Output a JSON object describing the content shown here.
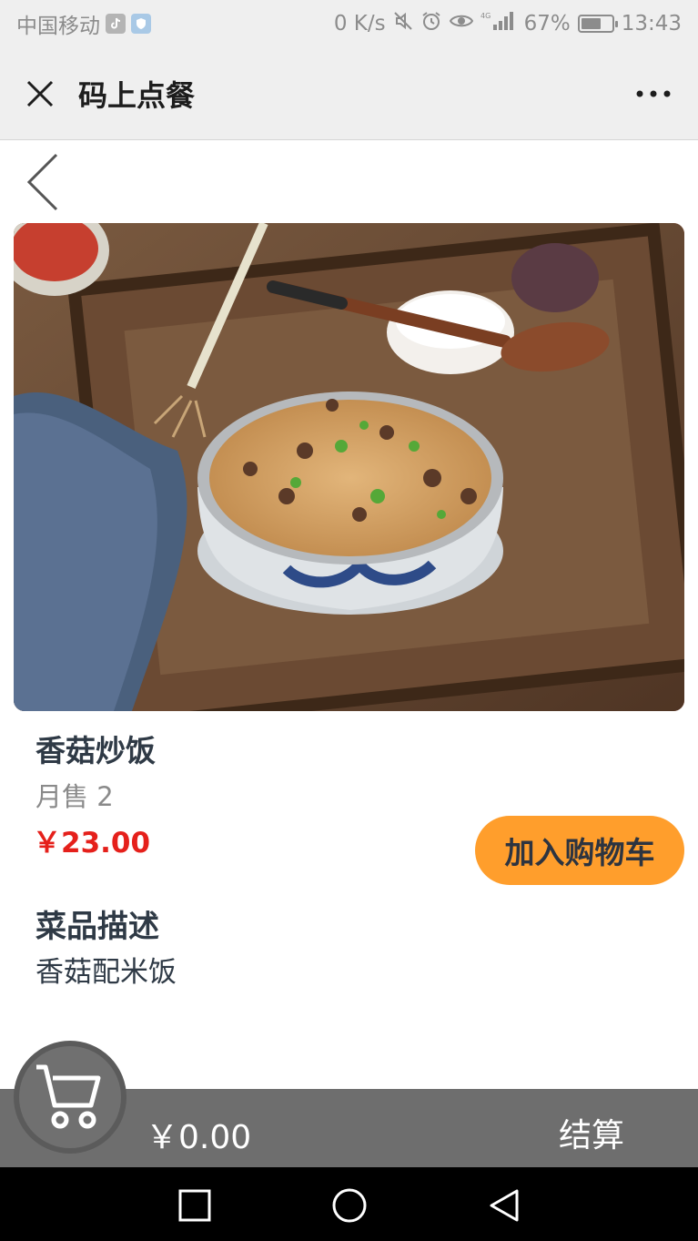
{
  "status_bar": {
    "carrier": "中国移动",
    "network_speed": "0 K/s",
    "network_type": "4G",
    "battery": "67%",
    "battery_level": 0.67,
    "time": "13:43"
  },
  "header": {
    "title": "码上点餐",
    "close_icon": "close-icon",
    "more_icon": "more-dots-icon"
  },
  "dish": {
    "name": "香菇炒饭",
    "monthly_sales": "月售 2",
    "price": "￥23.00",
    "add_to_cart_label": "加入购物车",
    "description_title": "菜品描述",
    "description": "香菇配米饭"
  },
  "cart": {
    "icon": "shopping-cart-icon",
    "total": "￥0.00",
    "checkout_label": "结算"
  },
  "colors": {
    "accent": "#ff9e2c",
    "price": "#e5201b",
    "cart_bar": "#6e6e6e",
    "header_bg": "#efefef"
  }
}
